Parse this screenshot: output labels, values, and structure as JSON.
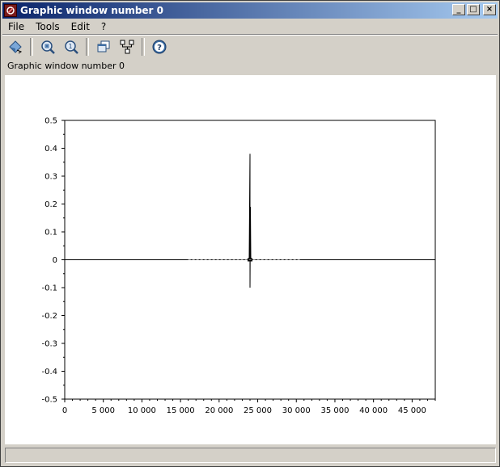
{
  "window": {
    "title": "Graphic window number 0",
    "buttons": {
      "minimize": "_",
      "maximize": "□",
      "close": "×"
    }
  },
  "menu": {
    "items": [
      "File",
      "Tools",
      "Edit",
      "?"
    ]
  },
  "toolbar": {
    "icons": [
      "rotate-icon",
      "zoom-icon",
      "unzoom-icon",
      "select-figure-icon",
      "datatip-icon",
      "help-icon"
    ]
  },
  "info_text": "Graphic window number 0",
  "chart_data": {
    "type": "line",
    "title": "",
    "xlabel": "",
    "ylabel": "",
    "xlim": [
      0,
      48000
    ],
    "ylim": [
      -0.5,
      0.5
    ],
    "x_ticks": [
      0,
      5000,
      10000,
      15000,
      20000,
      25000,
      30000,
      35000,
      40000,
      45000
    ],
    "x_tick_labels": [
      "0",
      "5 000",
      "10 000",
      "15 000",
      "20 000",
      "25 000",
      "30 000",
      "35 000",
      "40 000",
      "45 000"
    ],
    "y_ticks": [
      0.5,
      0.4,
      0.3,
      0.2,
      0.1,
      0,
      -0.1,
      -0.2,
      -0.3,
      -0.4,
      -0.5
    ],
    "y_tick_labels": [
      "0.5",
      "0.4",
      "0.3",
      "0.2",
      "0.1",
      "0",
      "-0.1",
      "-0.2",
      "-0.3",
      "-0.4",
      "-0.5"
    ],
    "grid": false,
    "series": [
      {
        "color": "#000000",
        "description_points": [
          {
            "x": 0,
            "y": 0
          },
          {
            "x": 16000,
            "y": 0
          },
          {
            "x": 23900,
            "y": 0
          },
          {
            "x": 24000,
            "y": 0.38
          },
          {
            "x": 24000,
            "y": -0.1
          },
          {
            "x": 24050,
            "y": 0.19
          },
          {
            "x": 24100,
            "y": 0
          },
          {
            "x": 30500,
            "y": 0
          },
          {
            "x": 48000,
            "y": 0
          }
        ]
      }
    ]
  }
}
